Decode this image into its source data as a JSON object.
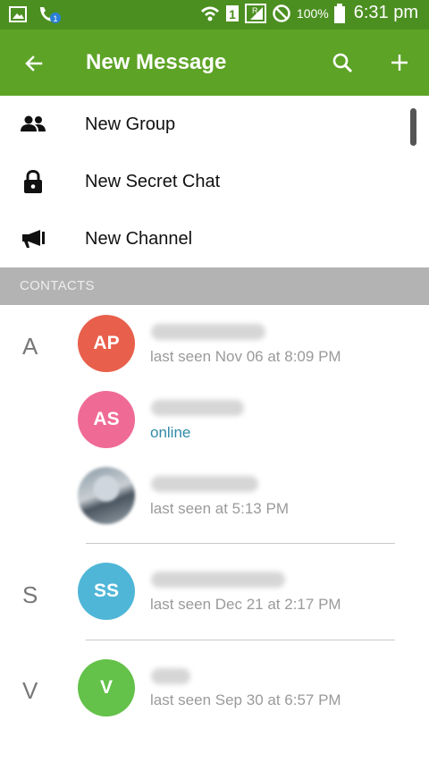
{
  "status_bar": {
    "battery": "100%",
    "time": "6:31 pm"
  },
  "app_bar": {
    "title": "New Message"
  },
  "menu": [
    {
      "label": "New Group",
      "icon": "group-icon"
    },
    {
      "label": "New Secret Chat",
      "icon": "lock-icon"
    },
    {
      "label": "New Channel",
      "icon": "megaphone-icon"
    }
  ],
  "section": {
    "label": "CONTACTS"
  },
  "contacts": [
    {
      "letter": "A",
      "initials": "AP",
      "color": "#e8604c",
      "status": "last seen Nov 06 at 8:09 PM"
    },
    {
      "letter": "",
      "initials": "AS",
      "color": "#ef6b96",
      "status": "online"
    },
    {
      "letter": "",
      "initials": "",
      "color": "#9aa6ae",
      "status": "last seen at 5:13 PM"
    },
    {
      "letter": "S",
      "initials": "SS",
      "color": "#4fb6d8",
      "status": "last seen Dec 21 at 2:17 PM"
    },
    {
      "letter": "V",
      "initials": "V",
      "color": "#64c14a",
      "status": "last seen Sep 30 at 6:57 PM"
    }
  ],
  "colors": {
    "status_bar": "#4c8f21",
    "app_bar": "#5da326",
    "online": "#2f8aa8"
  }
}
